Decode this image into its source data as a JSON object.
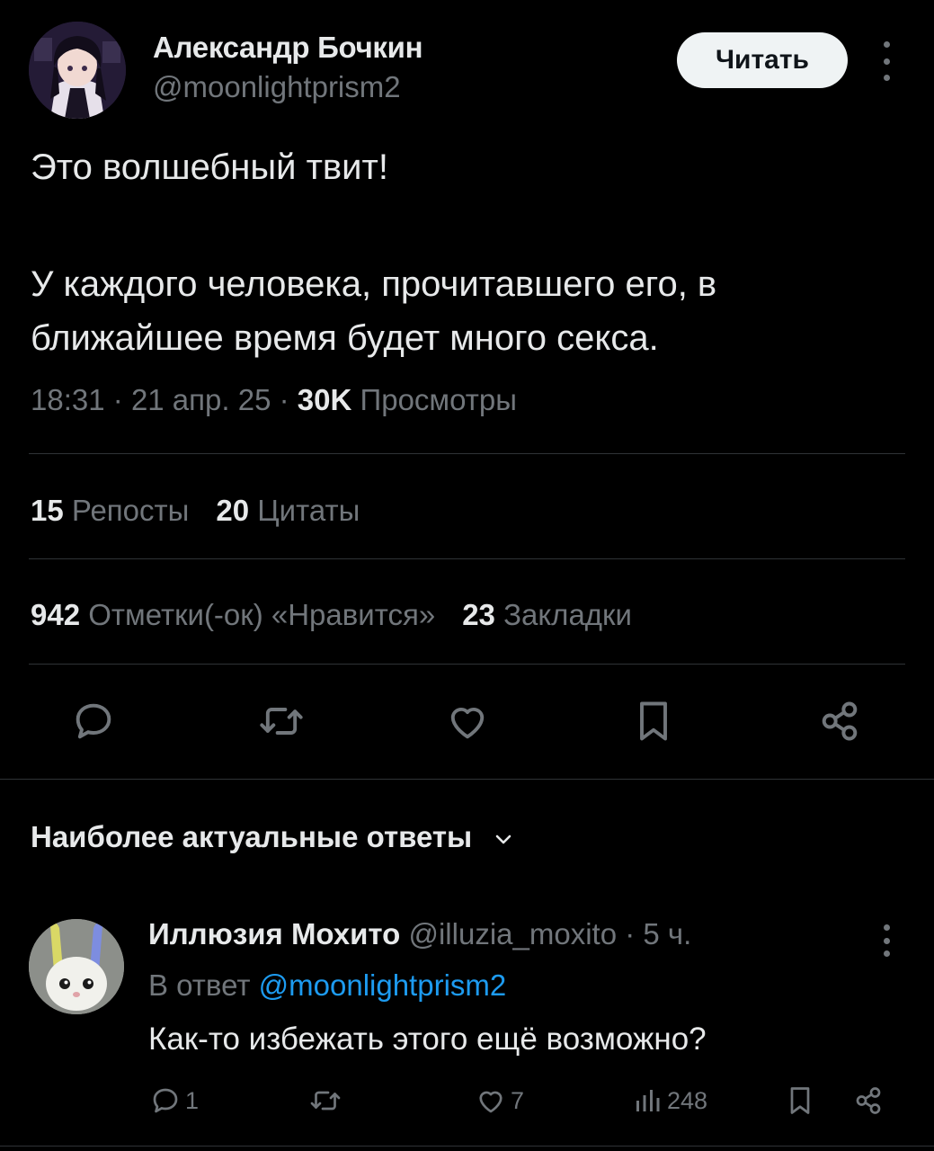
{
  "tweet": {
    "author_name": "Александр Бочкин",
    "author_handle": "@moonlightprism2",
    "follow_label": "Читать",
    "text_line1": "Это волшебный твит!",
    "text_line2": "У каждого человека, прочитавшего его, в",
    "text_line3": "ближайшее время будет много секса.",
    "time": "18:31",
    "date": "21 апр. 25",
    "separator": "·",
    "views_count": "30K",
    "views_label": "Просмотры"
  },
  "stats": {
    "reposts_count": "15",
    "reposts_label": "Репосты",
    "quotes_count": "20",
    "quotes_label": "Цитаты",
    "likes_count": "942",
    "likes_label": "Отметки(-ок) «Нравится»",
    "bookmarks_count": "23",
    "bookmarks_label": "Закладки"
  },
  "actions": [
    "reply-icon",
    "repost-icon",
    "like-icon",
    "bookmark-icon",
    "share-icon"
  ],
  "replies_section": {
    "title": "Наиболее актуальные ответы"
  },
  "reply": {
    "name": "Иллюзия Мохито",
    "handle": "@illuzia_moxito",
    "separator": "·",
    "age": "5 ч.",
    "in_reply_prefix": "В ответ",
    "in_reply_handle": "@moonlightprism2",
    "text": "Как-то избежать этого ещё возможно?",
    "reply_count": "1",
    "like_count": "7",
    "view_count": "248"
  },
  "colors": {
    "background": "#000000",
    "text": "#e7e9ea",
    "muted": "#71767b",
    "link": "#1d9bf0",
    "divider": "#2f3336"
  }
}
